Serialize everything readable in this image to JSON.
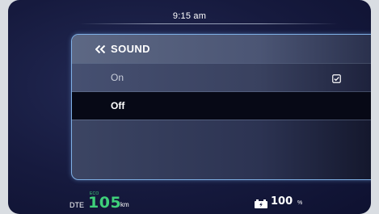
{
  "status": {
    "clock": "9:15 am"
  },
  "menu": {
    "title": "SOUND",
    "back_icon": "double-chevron-left-icon",
    "options": [
      {
        "label": "On",
        "checked": true,
        "icon": "checkbox-checked-icon"
      },
      {
        "label": "Off",
        "selected": true
      }
    ]
  },
  "footer": {
    "dte_label": "DTE",
    "mode_label": "ECO",
    "dte_value": "105",
    "dte_unit": "km",
    "battery_icon": "battery-charging-icon",
    "battery_value": "100",
    "battery_unit": "%"
  },
  "colors": {
    "accent_green": "#3fd07a",
    "panel_border": "#7fb0e6",
    "background": "#161a3e"
  }
}
